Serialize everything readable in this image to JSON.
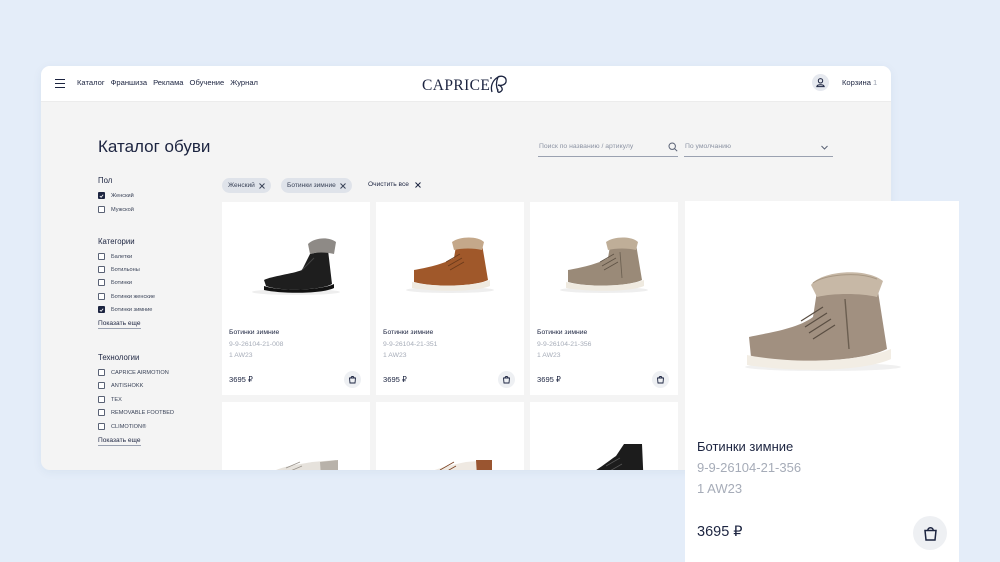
{
  "header": {
    "nav": [
      "Каталог",
      "Франшиза",
      "Реклама",
      "Обучение",
      "Журнал"
    ],
    "logo_text": "CAPRICE",
    "cart_label": "Корзина",
    "cart_count": "1"
  },
  "catalog": {
    "title": "Каталог обуви",
    "search_placeholder": "Поиск по названию / артикулу",
    "sort_value": "По умолчанию"
  },
  "filters": {
    "gender": {
      "title": "Пол",
      "items": [
        {
          "label": "Женский",
          "checked": true
        },
        {
          "label": "Мужской",
          "checked": false
        }
      ]
    },
    "categories": {
      "title": "Категории",
      "items": [
        {
          "label": "Балетки",
          "checked": false
        },
        {
          "label": "Ботильоны",
          "checked": false
        },
        {
          "label": "Ботинки",
          "checked": false
        },
        {
          "label": "Ботинки женские",
          "checked": false
        },
        {
          "label": "Ботинки зимние",
          "checked": true
        }
      ],
      "show_more": "Показать еще"
    },
    "technologies": {
      "title": "Технологии",
      "items": [
        {
          "label": "CAPRICE AIRMOTION",
          "checked": false
        },
        {
          "label": "ANTISHOKK",
          "checked": false
        },
        {
          "label": "TEX",
          "checked": false
        },
        {
          "label": "REMOVABLE FOOTBED",
          "checked": false
        },
        {
          "label": "CLIMOTION®",
          "checked": false
        }
      ],
      "show_more": "Показать еще"
    }
  },
  "active_filters": {
    "chips": [
      "Женский",
      "Ботинки зимние"
    ],
    "clear_all": "Очистить все"
  },
  "products": [
    {
      "name": "Ботинки зимние",
      "sku": "9-9-26104-21-008",
      "season": "1 AW23",
      "price": "3695 ₽",
      "color": "black"
    },
    {
      "name": "Ботинки зимние",
      "sku": "9-9-26104-21-351",
      "season": "1 AW23",
      "price": "3695 ₽",
      "color": "cognac"
    },
    {
      "name": "Ботинки зимние",
      "sku": "9-9-26104-21-356",
      "season": "1 AW23",
      "price": "3695 ₽",
      "color": "taupe"
    }
  ],
  "zoomed_product": {
    "name": "Ботинки зимние",
    "sku": "9-9-26104-21-356",
    "season": "1 AW23",
    "price": "3695 ₽"
  },
  "colors": {
    "background": "#e4edf9",
    "brand_navy": "#1c2440",
    "muted": "#a6acb8"
  }
}
